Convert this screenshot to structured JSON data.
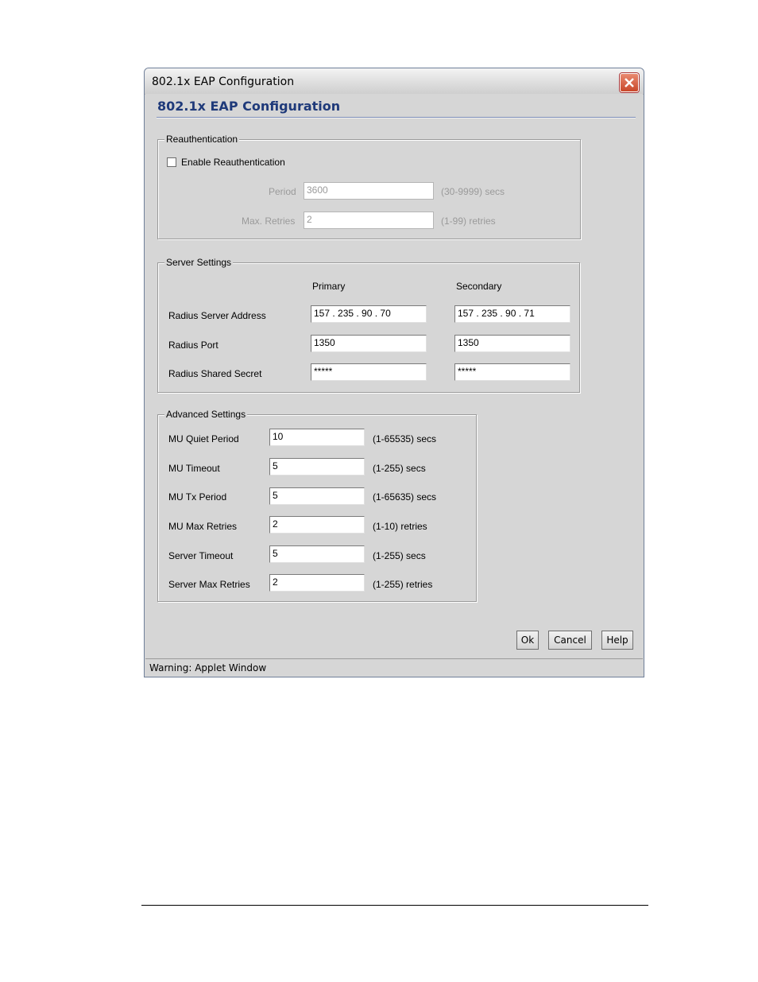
{
  "window": {
    "title": "802.1x EAP Configuration",
    "heading": "802.1x EAP Configuration",
    "status_text": "Warning: Applet Window"
  },
  "reauth": {
    "group_label": "Reauthentication",
    "enable_label": "Enable Reauthentication",
    "enable_checked": false,
    "period_label": "Period",
    "period_value": "3600",
    "period_hint": "(30-9999) secs",
    "retries_label": "Max. Retries",
    "retries_value": "2",
    "retries_hint": "(1-99) retries"
  },
  "server": {
    "group_label": "Server Settings",
    "primary_header": "Primary",
    "secondary_header": "Secondary",
    "rows": [
      {
        "label": "Radius Server Address",
        "primary": "157 . 235 . 90   . 70",
        "secondary": "157 . 235 . 90   . 71"
      },
      {
        "label": "Radius Port",
        "primary": "1350",
        "secondary": "1350"
      },
      {
        "label": "Radius Shared Secret",
        "primary": "*****",
        "secondary": "*****"
      }
    ]
  },
  "advanced": {
    "group_label": "Advanced Settings",
    "rows": [
      {
        "label": "MU Quiet Period",
        "value": "10",
        "hint": "(1-65535) secs"
      },
      {
        "label": "MU Timeout",
        "value": "5",
        "hint": "(1-255) secs"
      },
      {
        "label": "MU Tx Period",
        "value": "5",
        "hint": "(1-65635) secs"
      },
      {
        "label": "MU Max Retries",
        "value": "2",
        "hint": "(1-10) retries"
      },
      {
        "label": "Server Timeout",
        "value": "5",
        "hint": "(1-255) secs"
      },
      {
        "label": "Server Max Retries",
        "value": "2",
        "hint": "(1-255) retries"
      }
    ]
  },
  "buttons": {
    "ok": "Ok",
    "cancel": "Cancel",
    "help": "Help"
  },
  "icons": {
    "close": "close-icon"
  }
}
